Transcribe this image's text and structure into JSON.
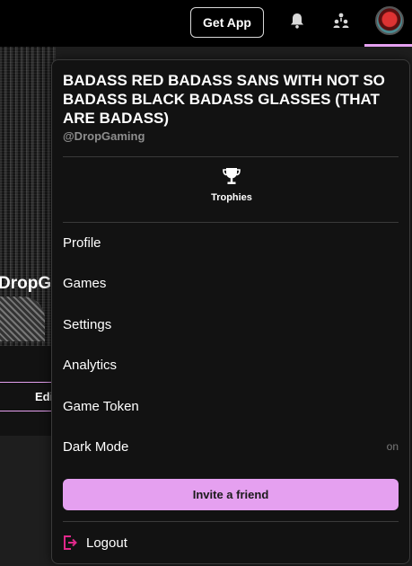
{
  "topbar": {
    "get_app_label": "Get App",
    "icons": [
      "bell-icon",
      "people-icon",
      "avatar"
    ],
    "accent_color": "#e5a0f0"
  },
  "background_page": {
    "profile_name": "DropGa",
    "edit_label": "Edi"
  },
  "menu": {
    "title": "BADASS RED BADASS SANS WITH NOT SO BADASS BLACK BADASS GLASSES (THAT ARE BADASS)",
    "handle": "@DropGaming",
    "trophies_label": "Trophies",
    "items": [
      {
        "label": "Profile"
      },
      {
        "label": "Games"
      },
      {
        "label": "Settings"
      },
      {
        "label": "Analytics"
      },
      {
        "label": "Game Token"
      },
      {
        "label": "Dark Mode",
        "value": "on"
      }
    ],
    "invite_label": "Invite a friend",
    "logout_label": "Logout",
    "logout_icon_color": "#e0288a"
  }
}
